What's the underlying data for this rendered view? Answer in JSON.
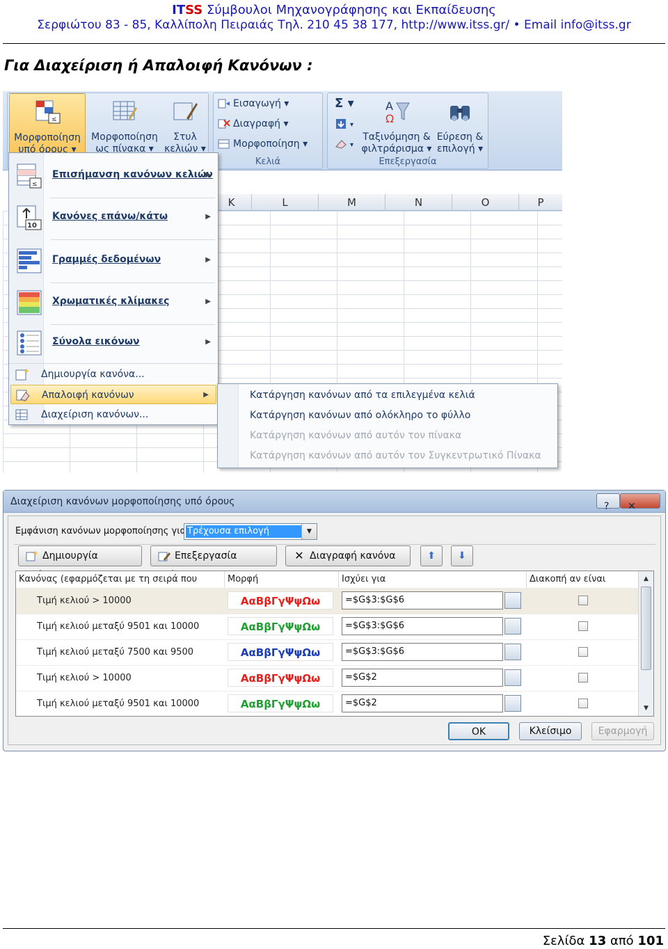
{
  "header": {
    "brand_it": "IT",
    "brand_ss": "SS",
    "tagline": "Σύμβουλοι Μηχανογράφησης και Εκπαίδευσης",
    "address": "Σερφιώτου 83 - 85, Καλλίπολη Πειραιάς Τηλ. 210 45 38 177, http://www.itss.gr/ •  Email info@itss.gr"
  },
  "section_title": "Για Διαχείριση ή Απαλοιφή Κανόνων :",
  "ribbon": {
    "styles_buttons": [
      {
        "label1": "Μορφοποίηση",
        "label2": "υπό όρους ▾",
        "icon": "conditional-formatting-icon",
        "active": true
      },
      {
        "label1": "Μορφοποίηση",
        "label2": "ως πίνακα ▾",
        "icon": "format-as-table-icon",
        "active": false
      },
      {
        "label1": "Στυλ",
        "label2": "κελιών ▾",
        "icon": "cell-styles-icon",
        "active": false
      }
    ],
    "cells_group": {
      "label": "Κελιά",
      "items": [
        {
          "label": "Εισαγωγή ▾",
          "icon": "insert-cells-icon"
        },
        {
          "label": "Διαγραφή ▾",
          "icon": "delete-cells-icon"
        },
        {
          "label": "Μορφοποίηση ▾",
          "icon": "format-cells-icon"
        }
      ]
    },
    "editing_group": {
      "label": "Επεξεργασία",
      "small_icons": [
        "sum-icon",
        "fill-icon",
        "clear-icon"
      ],
      "sort_label1": "Ταξινόμηση &",
      "sort_label2": "φιλτράρισμα ▾",
      "find_label1": "Εύρεση &",
      "find_label2": "επιλογή ▾"
    }
  },
  "columns": [
    "K",
    "L",
    "M",
    "N",
    "O",
    "P"
  ],
  "cf_menu": {
    "big_items": [
      {
        "label": "Επισήμανση κανόνων κελιών",
        "icon": "highlight-cells-rules-icon"
      },
      {
        "label": "Κανόνες επάνω/κάτω",
        "icon": "top-bottom-rules-icon"
      },
      {
        "label": "Γραμμές δεδομένων",
        "icon": "data-bars-icon"
      },
      {
        "label": "Χρωματικές κλίμακες",
        "icon": "color-scales-icon"
      },
      {
        "label": "Σύνολα εικόνων",
        "icon": "icon-sets-icon"
      }
    ],
    "small_items": [
      {
        "label": "Δημιουργία κανόνα...",
        "icon": "new-rule-icon"
      },
      {
        "label": "Απαλοιφή κανόνων",
        "icon": "clear-rules-icon"
      },
      {
        "label": "Διαχείριση κανόνων...",
        "icon": "manage-rules-icon"
      }
    ],
    "clear_submenu": [
      {
        "label": "Κατάργηση κανόνων από τα επιλεγμένα κελιά",
        "enabled": true
      },
      {
        "label": "Κατάργηση κανόνων από ολόκληρο το φύλλο",
        "enabled": true
      },
      {
        "label": "Κατάργηση κανόνων από αυτόν τον πίνακα",
        "enabled": false
      },
      {
        "label": "Κατάργηση κανόνων από αυτόν τον Συγκεντρωτικό Πίνακα",
        "enabled": false
      }
    ]
  },
  "dialog": {
    "title": "Διαχείριση κανόνων μορφοποίησης υπό όρους",
    "help": "?",
    "close": "✕",
    "show_rules_label": "Εμφάνιση κανόνων μορφοποίησης για:",
    "show_rules_value": "Τρέχουσα επιλογή",
    "new_rule": "Δημιουργία κανόνα...",
    "edit_rule": "Επεξεργασία κανόνα...",
    "delete_rule": "Διαγραφή κανόνα",
    "columns": {
      "rule": "Κανόνας (εφαρμόζεται με τη σειρά που φαίνεται)",
      "format": "Μορφή",
      "applies_to": "Ισχύει για",
      "stop_if_true": "Διακοπή αν είναι αληθές"
    },
    "rules": [
      {
        "rule": "Τιμή κελιού > 10000",
        "sample": "ΑαΒβΓγΨψΩω",
        "color": "#e8201c",
        "applies_to": "=$G$3:$G$6",
        "stop": false
      },
      {
        "rule": "Τιμή κελιού μεταξύ 9501 και 10000",
        "sample": "ΑαΒβΓγΨψΩω",
        "color": "#1fa030",
        "applies_to": "=$G$3:$G$6",
        "stop": false
      },
      {
        "rule": "Τιμή κελιού μεταξύ 7500 και 9500",
        "sample": "ΑαΒβΓγΨψΩω",
        "color": "#1a3eb8",
        "applies_to": "=$G$3:$G$6",
        "stop": false
      },
      {
        "rule": "Τιμή κελιού > 10000",
        "sample": "ΑαΒβΓγΨψΩω",
        "color": "#e8201c",
        "applies_to": "=$G$2",
        "stop": false
      },
      {
        "rule": "Τιμή κελιού μεταξύ 9501 και 10000",
        "sample": "ΑαΒβΓγΨψΩω",
        "color": "#1fa030",
        "applies_to": "=$G$2",
        "stop": false
      }
    ],
    "ok": "OK",
    "close_btn": "Κλείσιμο",
    "apply": "Εφαρμογή"
  },
  "footer": {
    "page_word": "Σελίδα",
    "page": "13",
    "of_word": "από",
    "total": "101"
  }
}
